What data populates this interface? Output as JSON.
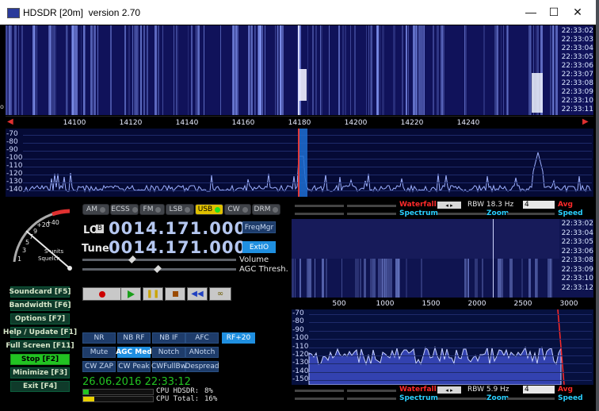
{
  "window": {
    "title": "HDSDR [20m]  version 2.70",
    "controls": {
      "minimize": "—",
      "maximize": "☐",
      "close": "✕"
    }
  },
  "main_waterfall": {
    "times": [
      "22:33:02",
      "22:33:03",
      "22:33:04",
      "22:33:05",
      "22:33:06",
      "22:33:07",
      "22:33:08",
      "22:33:09",
      "22:33:10",
      "22:33:11"
    ]
  },
  "main_scale": {
    "freqs": [
      "14100",
      "14120",
      "14140",
      "14160",
      "14180",
      "14200",
      "14220",
      "14240"
    ]
  },
  "main_spectrum": {
    "db_labels": [
      "-70",
      "-80",
      "-90",
      "-100",
      "-110",
      "-120",
      "-130",
      "-140"
    ]
  },
  "smeter": {
    "labels": [
      "+40",
      "+20",
      "9",
      "7",
      "5",
      "3",
      "1"
    ],
    "legend": "S-units",
    "squelch": "Squelch"
  },
  "modes": [
    {
      "label": "AM",
      "active": false
    },
    {
      "label": "ECSS",
      "active": false
    },
    {
      "label": "FM",
      "active": false
    },
    {
      "label": "LSB",
      "active": false
    },
    {
      "label": "USB",
      "active": true
    },
    {
      "label": "CW",
      "active": false
    },
    {
      "label": "DRM",
      "active": false
    }
  ],
  "lo": {
    "label": "LO",
    "badge": "B",
    "value": "0014.171.000"
  },
  "tune": {
    "label": "Tune",
    "value": "0014.171.000"
  },
  "freqmgr_label": "FreqMgr",
  "extio_label": "ExtIO",
  "volume_label": "Volume",
  "agc_label": "AGC Thresh.",
  "left_buttons": [
    {
      "label": "Soundcard  [F5]"
    },
    {
      "label": "Bandwidth  [F6]"
    },
    {
      "label": "Options    [F7]"
    },
    {
      "label": "Help / Update  [F1]"
    },
    {
      "label": "Full Screen  [F11]"
    },
    {
      "label": "Stop       [F2]"
    },
    {
      "label": "Minimize  [F3]"
    },
    {
      "label": "Exit       [F4]"
    }
  ],
  "dsp_buttons": [
    {
      "label": "NR"
    },
    {
      "label": "NB RF"
    },
    {
      "label": "NB IF"
    },
    {
      "label": "AFC"
    },
    {
      "label": "RF+20"
    },
    {
      "label": "Mute"
    },
    {
      "label": "AGC Med"
    },
    {
      "label": "Notch"
    },
    {
      "label": "ANotch"
    },
    {
      "label": "CW ZAP"
    },
    {
      "label": "CW Peak"
    },
    {
      "label": "CWFullBw"
    },
    {
      "label": "Despread"
    }
  ],
  "datetime": "26.06.2016 22:33:12",
  "cpu_hdsdr": {
    "label": "CPU HDSDR:",
    "value": "8%",
    "fraction": 0.08
  },
  "cpu_total": {
    "label": "CPU Total:",
    "value": "16%",
    "fraction": 0.16
  },
  "panel_top": {
    "waterfall": "Waterfall",
    "spectrum": "Spectrum",
    "rbw": "RBW  18.3 Hz",
    "avg_value": "4",
    "zoom": "Zoom",
    "avg": "Avg",
    "speed": "Speed"
  },
  "sub_waterfall": {
    "times": [
      "22:33:02",
      "22:33:04",
      "22:33:05",
      "22:33:06",
      "22:33:08",
      "22:33:09",
      "22:33:10",
      "22:33:12"
    ]
  },
  "sub_scale": {
    "freqs": [
      "500",
      "1000",
      "1500",
      "2000",
      "2500",
      "3000"
    ]
  },
  "sub_spectrum": {
    "db_labels": [
      "-70",
      "-80",
      "-90",
      "-100",
      "-110",
      "-120",
      "-130",
      "-140",
      "-150"
    ]
  },
  "panel_bottom": {
    "waterfall": "Waterfall",
    "spectrum": "Spectrum",
    "rbw": "RBW  5.9 Hz",
    "avg_value": "4",
    "zoom": "Zoom",
    "avg": "Avg",
    "speed": "Speed"
  },
  "colors": {
    "accent_green": "#22c322",
    "title_red": "#ff2a2a",
    "title_cyan": "#2ad0ff",
    "freq_blue": "#b5c7f0"
  }
}
